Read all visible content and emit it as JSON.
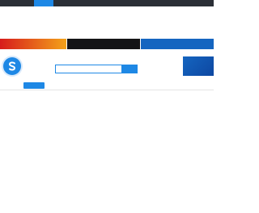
{
  "header": {
    "nav": [
      {
        "label": "",
        "active": false
      },
      {
        "label": "",
        "active": false
      },
      {
        "label": "",
        "active": true
      },
      {
        "label": "",
        "active": false
      },
      {
        "label": "",
        "active": false
      },
      {
        "label": "",
        "active": false
      },
      {
        "label": "",
        "active": false
      },
      {
        "label": "",
        "active": false
      },
      {
        "label": "",
        "active": false
      },
      {
        "label": "",
        "active": false
      },
      {
        "label": "",
        "active": false
      }
    ]
  },
  "link_columns": [
    [
      "",
      "",
      "",
      "",
      "",
      "",
      "",
      ""
    ],
    [
      "",
      "",
      "",
      "",
      "",
      "",
      "",
      ""
    ],
    [
      "",
      "",
      "",
      "",
      "",
      "",
      "",
      ""
    ],
    [
      "",
      "",
      "",
      "",
      "",
      "",
      "",
      ""
    ],
    [
      "",
      "",
      "",
      "",
      "",
      "",
      "",
      ""
    ]
  ],
  "banners": {
    "left": "",
    "middle": "",
    "right": ""
  },
  "brand": {
    "icon": "s-logo-icon",
    "name": ""
  },
  "search": {
    "placeholder": "",
    "select_value": "",
    "button_label": ""
  },
  "ad": {
    "line1": "",
    "line2": ""
  },
  "tabs": [
    {
      "label": "",
      "active": false
    },
    {
      "label": "",
      "active": true
    },
    {
      "label": "",
      "active": false
    },
    {
      "label": "",
      "active": false
    },
    {
      "label": "",
      "active": false
    },
    {
      "label": "",
      "active": false
    },
    {
      "label": "",
      "active": false
    },
    {
      "label": "",
      "active": false
    },
    {
      "label": "",
      "active": false
    },
    {
      "label": "",
      "active": false
    }
  ],
  "result": {
    "empty_message": ""
  },
  "footer": {
    "lines": [
      "",
      "",
      "",
      "",
      "",
      ""
    ]
  },
  "colors": {
    "accent": "#1e88e5",
    "topbar": "#2b2f36",
    "banner_left": "#d71c1c",
    "banner_mid": "#141416",
    "banner_right": "#1565c0"
  }
}
